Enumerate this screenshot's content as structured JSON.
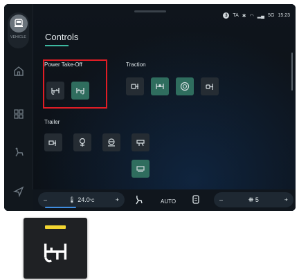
{
  "vehicle_label": "VEHICLE",
  "page_title": "Controls",
  "status": {
    "badge": "3",
    "ta": "TA",
    "network": "5G",
    "time": "15:23"
  },
  "sections": {
    "pto": {
      "label": "Power Take-Off"
    },
    "traction": {
      "label": "Traction"
    },
    "trailer": {
      "label": "Trailer"
    }
  },
  "climate": {
    "left_minus": "–",
    "left_temp": "24.0",
    "left_unit": "°C",
    "left_plus": "+",
    "mode": "AUTO",
    "fan_minus": "–",
    "fan_level": "5",
    "fan_plus": "+"
  },
  "colors": {
    "accent": "#3db8a0",
    "active_button": "#2f6d5e",
    "highlight": "#e11d25",
    "indicator": "#f3d631"
  }
}
